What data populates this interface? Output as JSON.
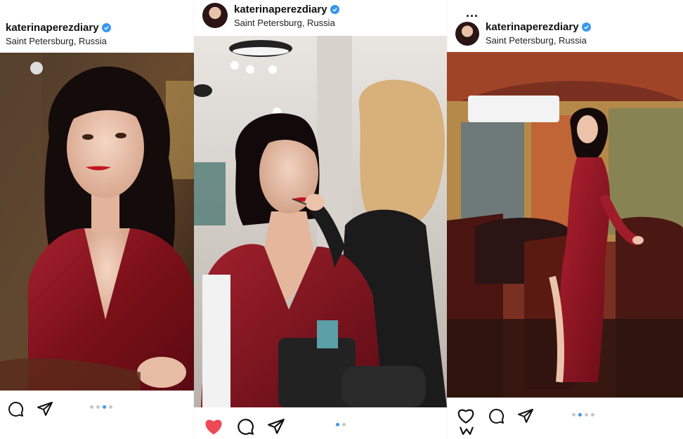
{
  "posts": [
    {
      "username": "katerinaperezdiary",
      "location": "Saint Petersburg, Russia",
      "dots": 4,
      "active_dot": 2,
      "liked": false
    },
    {
      "username": "katerinaperezdiary",
      "location": "Saint Petersburg, Russia",
      "dots": 2,
      "active_dot": 0,
      "liked": true
    },
    {
      "username": "katerinaperezdiary",
      "location": "Saint Petersburg, Russia",
      "dots": 4,
      "active_dot": 1,
      "liked": false,
      "more_label": "..."
    }
  ],
  "icons": [
    "heart-icon",
    "comment-icon",
    "share-icon",
    "verified-icon",
    "more-icon",
    "bookmark-icon"
  ],
  "colors": {
    "accent": "#3897f0",
    "like": "#ed4956",
    "dress": "#8c1620"
  }
}
